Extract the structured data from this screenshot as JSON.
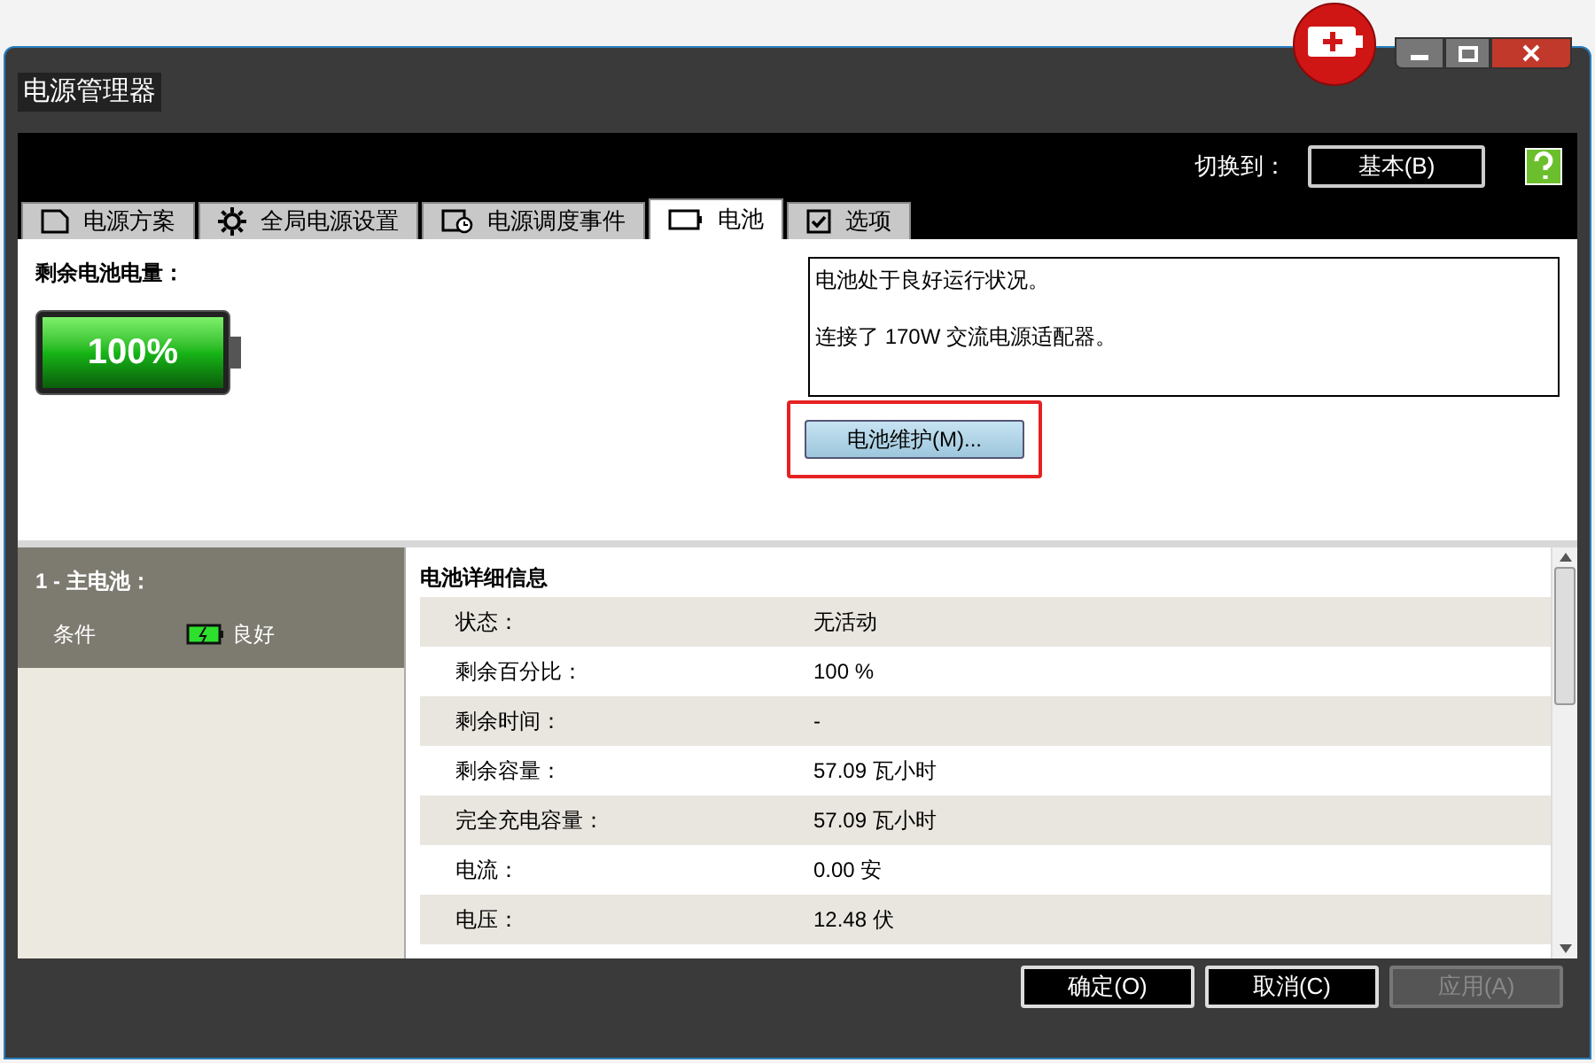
{
  "window": {
    "title": "电源管理器"
  },
  "switch": {
    "label": "切换到：",
    "button": "基本(B)"
  },
  "tabs": [
    {
      "label": "电源方案",
      "kind": "plan",
      "selected": false
    },
    {
      "label": "全局电源设置",
      "kind": "gear",
      "selected": false
    },
    {
      "label": "电源调度事件",
      "kind": "clock",
      "selected": false
    },
    {
      "label": "电池",
      "kind": "battery",
      "selected": true
    },
    {
      "label": "选项",
      "kind": "check",
      "selected": false
    }
  ],
  "charge": {
    "label": "剩余电池电量：",
    "reading": "100%",
    "level": 1
  },
  "status_box": {
    "lines": [
      "电池处于良好运行状况。",
      "连接了 170W 交流电源适配器。"
    ]
  },
  "maintenance_button": {
    "label": "电池维护(M)...",
    "highlighted": true
  },
  "battery_list": [
    {
      "title": "1 - 主电池：",
      "condition_label": "条件",
      "condition": "良好",
      "selected": true
    }
  ],
  "details": {
    "title": "电池详细信息",
    "rows": [
      {
        "label": "状态：",
        "value": "无活动"
      },
      {
        "label": "剩余百分比：",
        "value": "100 %"
      },
      {
        "label": "剩余时间：",
        "value": "-"
      },
      {
        "label": "剩余容量：",
        "value": "57.09 瓦小时"
      },
      {
        "label": "完全充电容量：",
        "value": "57.09 瓦小时"
      },
      {
        "label": "电流：",
        "value": "0.00 安"
      },
      {
        "label": "电压：",
        "value": "12.48 伏"
      }
    ]
  },
  "buttons": [
    {
      "label": "确定(O)",
      "disabled": false
    },
    {
      "label": "取消(C)",
      "disabled": false
    },
    {
      "label": "应用(A)",
      "disabled": true
    }
  ]
}
